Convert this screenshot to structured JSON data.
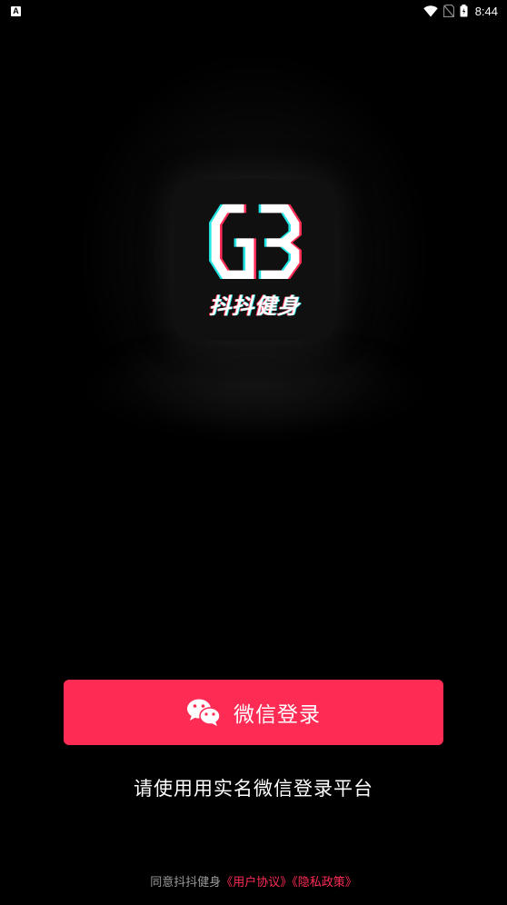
{
  "status_bar": {
    "notification_icon": "A",
    "time": "8:44"
  },
  "logo": {
    "text": "抖抖健身"
  },
  "login": {
    "wechat_button_label": "微信登录"
  },
  "hint": {
    "text": "请使用用实名微信登录平台"
  },
  "agreement": {
    "prefix": "同意抖抖健身",
    "user_agreement": "《用户协议》",
    "privacy_policy": "《隐私政策》"
  },
  "colors": {
    "accent": "#fe2c55",
    "background": "#000000",
    "agreement_text": "#9a9a9a"
  }
}
